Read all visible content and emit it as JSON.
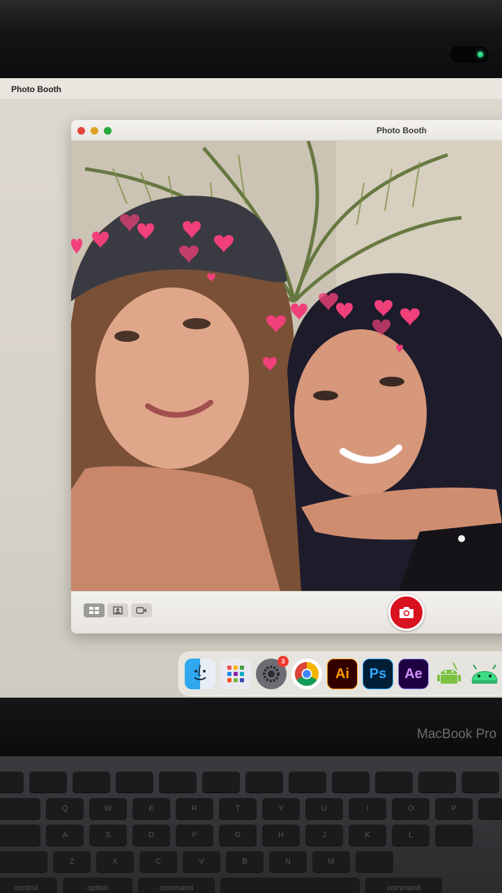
{
  "menubar": {
    "app_name": "Photo Booth"
  },
  "window": {
    "title": "Photo Booth"
  },
  "toolbar": {
    "modes": [
      "grid-mode-icon",
      "single-photo-icon",
      "video-icon"
    ],
    "active_mode": 0,
    "shutter_icon": "camera-icon"
  },
  "dock": {
    "items": [
      {
        "name": "finder-icon",
        "label": ""
      },
      {
        "name": "launchpad-icon",
        "label": ""
      },
      {
        "name": "system-settings-icon",
        "label": "",
        "badge": "3"
      },
      {
        "name": "chrome-icon",
        "label": ""
      },
      {
        "name": "illustrator-icon",
        "label": "Ai"
      },
      {
        "name": "photoshop-icon",
        "label": "Ps"
      },
      {
        "name": "after-effects-icon",
        "label": "Ae"
      },
      {
        "name": "android-studio-icon",
        "label": ""
      },
      {
        "name": "android-icon",
        "label": ""
      }
    ]
  },
  "laptop": {
    "brand": "MacBook Pro"
  },
  "keyboard": {
    "row2": [
      "",
      "Q",
      "W",
      "E",
      "R",
      "T",
      "Y",
      "U",
      "I",
      "O",
      "P",
      ""
    ],
    "row3": [
      "",
      "A",
      "S",
      "D",
      "F",
      "G",
      "H",
      "J",
      "K",
      "L",
      ""
    ],
    "row4": [
      "",
      "Z",
      "X",
      "C",
      "V",
      "B",
      "N",
      "M",
      ""
    ],
    "row5": [
      "control",
      "option",
      "command",
      "",
      "command"
    ]
  },
  "colors": {
    "shutter": "#d8121f",
    "heart": "#f0407a",
    "camera_led": "#2fe08a"
  }
}
